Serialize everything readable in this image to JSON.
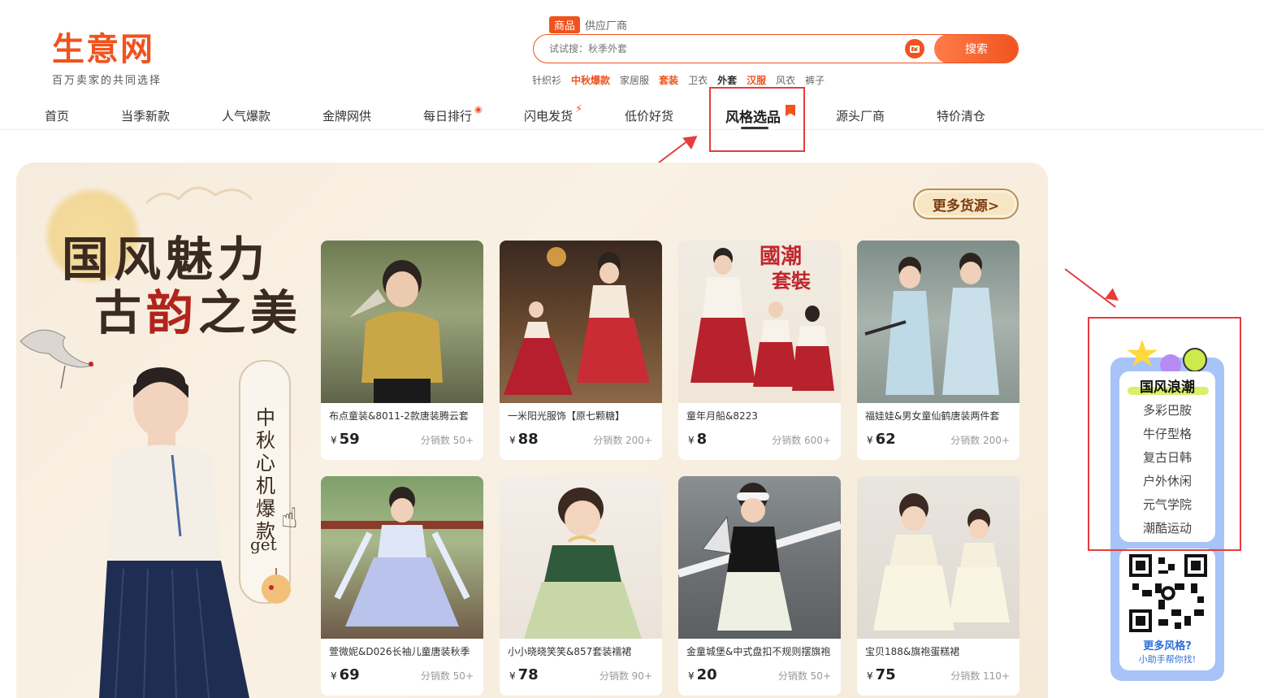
{
  "header": {
    "logo_text": "生意网",
    "logo_slogan": "百万卖家的共同选择"
  },
  "search": {
    "tabs": [
      {
        "label": "商品",
        "active": true
      },
      {
        "label": "供应厂商",
        "active": false
      }
    ],
    "placeholder": "试试搜：秋季外套",
    "button_label": "搜索",
    "camera_icon": "camera-icon",
    "hotwords": [
      {
        "label": "针织衫",
        "style": "normal"
      },
      {
        "label": "中秋爆款",
        "style": "hot"
      },
      {
        "label": "家居服",
        "style": "normal"
      },
      {
        "label": "套装",
        "style": "hot"
      },
      {
        "label": "卫衣",
        "style": "normal"
      },
      {
        "label": "外套",
        "style": "dark"
      },
      {
        "label": "汉服",
        "style": "hot"
      },
      {
        "label": "风衣",
        "style": "normal"
      },
      {
        "label": "裤子",
        "style": "normal"
      }
    ]
  },
  "nav": {
    "items": [
      {
        "label": "首页"
      },
      {
        "label": "当季新款"
      },
      {
        "label": "人气爆款"
      },
      {
        "label": "金牌网供"
      },
      {
        "label": "每日排行"
      },
      {
        "label": "闪电发货"
      },
      {
        "label": "低价好货"
      },
      {
        "label": "风格选品",
        "active": true
      },
      {
        "label": "源头厂商"
      },
      {
        "label": "特价清仓"
      }
    ]
  },
  "banner": {
    "title_line1": "国风魅力",
    "title_line2_a": "古",
    "title_line2_b": "韵",
    "title_line2_c": "之美",
    "vertical_text": "中秋心机爆款",
    "vertical_get": "get",
    "more_button": "更多货源>"
  },
  "products": [
    {
      "title": "布点童装&8011-2款唐装腾云套",
      "price": "59",
      "sold": "分销数 50+"
    },
    {
      "title": "一米阳光服饰【原七颗糖】",
      "price": "88",
      "sold": "分销数 200+"
    },
    {
      "title": "童年月船&8223",
      "price": "8",
      "sold": "分销数 600+"
    },
    {
      "title": "福娃娃&男女童仙鹤唐装两件套",
      "price": "62",
      "sold": "分销数 200+"
    },
    {
      "title": "萱微妮&D026长袖儿童唐装秋季",
      "price": "69",
      "sold": "分销数 50+"
    },
    {
      "title": "小小晓晓笑笑&857套装襦裙",
      "price": "78",
      "sold": "分销数 90+"
    },
    {
      "title": "金童城堡&中式盘扣不规则摆旗袍",
      "price": "20",
      "sold": "分销数 50+"
    },
    {
      "title": "宝贝188&旗袍蛋糕裙",
      "price": "75",
      "sold": "分销数 110+"
    }
  ],
  "currency_symbol": "¥",
  "widget": {
    "title": "国风浪潮",
    "items": [
      "多彩巴胺",
      "牛仔型格",
      "复古日韩",
      "户外休闲",
      "元气学院",
      "潮酷运动"
    ],
    "more_title": "更多风格?",
    "more_sub": "小助手帮你找!"
  },
  "colors": {
    "brand": "#f0531e",
    "annotation_red": "#e63c3c",
    "widget_blue": "#a8c3f7",
    "banner_bg": "#f6ecdd"
  }
}
